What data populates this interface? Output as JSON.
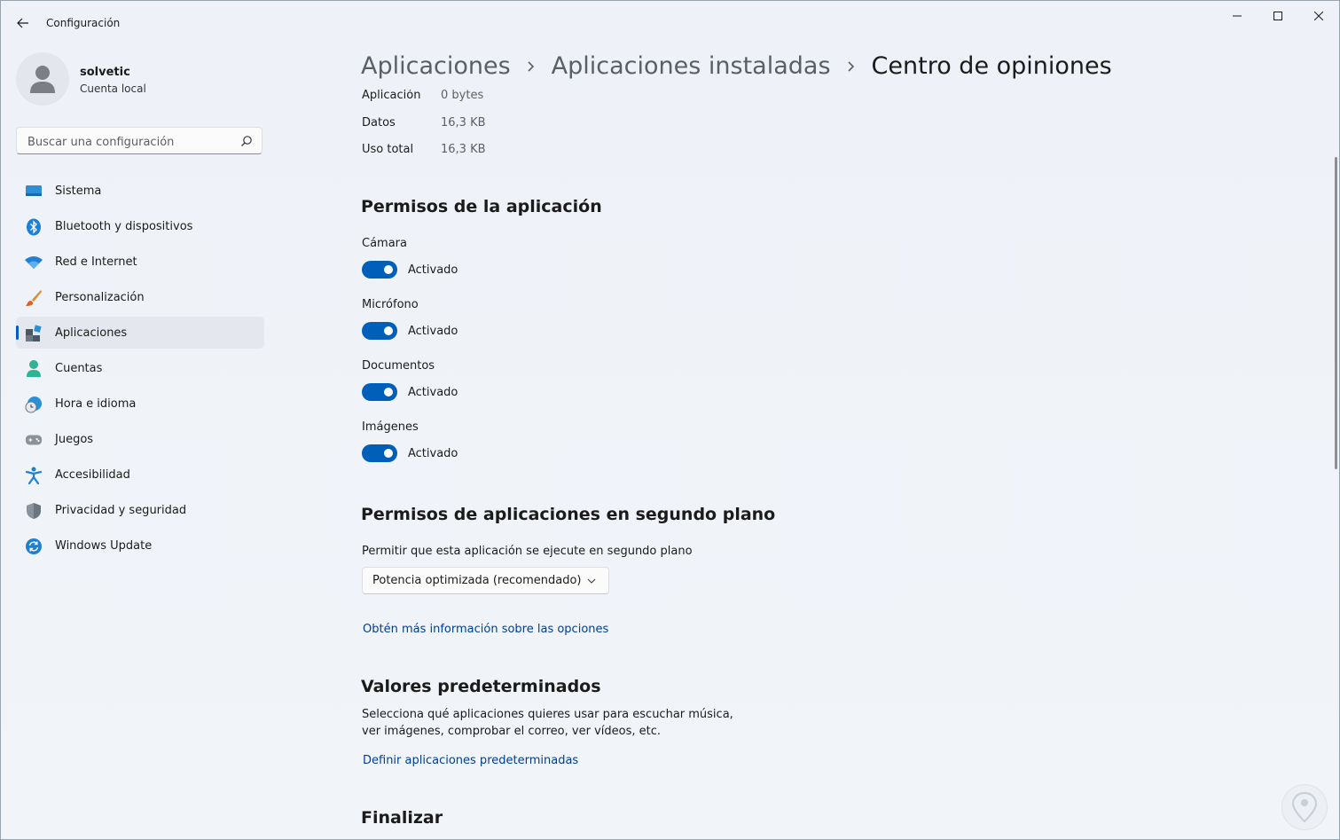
{
  "window": {
    "title": "Configuración"
  },
  "user": {
    "name": "solvetic",
    "account_type": "Cuenta local"
  },
  "search": {
    "placeholder": "Buscar una configuración"
  },
  "nav": {
    "items": [
      {
        "label": "Sistema",
        "icon": "monitor-icon"
      },
      {
        "label": "Bluetooth y dispositivos",
        "icon": "bluetooth-icon"
      },
      {
        "label": "Red e Internet",
        "icon": "wifi-icon"
      },
      {
        "label": "Personalización",
        "icon": "paintbrush-icon"
      },
      {
        "label": "Aplicaciones",
        "icon": "apps-icon",
        "active": true
      },
      {
        "label": "Cuentas",
        "icon": "person-icon"
      },
      {
        "label": "Hora e idioma",
        "icon": "globe-clock-icon"
      },
      {
        "label": "Juegos",
        "icon": "gamepad-icon"
      },
      {
        "label": "Accesibilidad",
        "icon": "accessibility-icon"
      },
      {
        "label": "Privacidad y seguridad",
        "icon": "shield-icon"
      },
      {
        "label": "Windows Update",
        "icon": "update-icon"
      }
    ]
  },
  "breadcrumb": {
    "items": [
      "Aplicaciones",
      "Aplicaciones instaladas",
      "Centro de opiniones"
    ]
  },
  "storage": {
    "app_label": "Aplicación",
    "app_value": "0 bytes",
    "data_label": "Datos",
    "data_value": "16,3 KB",
    "total_label": "Uso total",
    "total_value": "16,3 KB"
  },
  "permissions": {
    "title": "Permisos de la aplicación",
    "items": [
      {
        "label": "Cámara",
        "state": "Activado",
        "on": true
      },
      {
        "label": "Micrófono",
        "state": "Activado",
        "on": true
      },
      {
        "label": "Documentos",
        "state": "Activado",
        "on": true
      },
      {
        "label": "Imágenes",
        "state": "Activado",
        "on": true
      }
    ]
  },
  "background": {
    "title": "Permisos de aplicaciones en segundo plano",
    "question": "Permitir que esta aplicación se ejecute en segundo plano",
    "selected_option": "Potencia optimizada (recomendado)",
    "link": "Obtén más información sobre las opciones"
  },
  "defaults": {
    "title": "Valores predeterminados",
    "description": "Selecciona qué aplicaciones quieres usar para escuchar música, ver imágenes, comprobar el correo, ver vídeos, etc.",
    "link": "Definir aplicaciones predeterminadas"
  },
  "finish": {
    "title": "Finalizar"
  },
  "colors": {
    "accent": "#005fb8",
    "link": "#003e92",
    "background": "#f0f4f9"
  }
}
